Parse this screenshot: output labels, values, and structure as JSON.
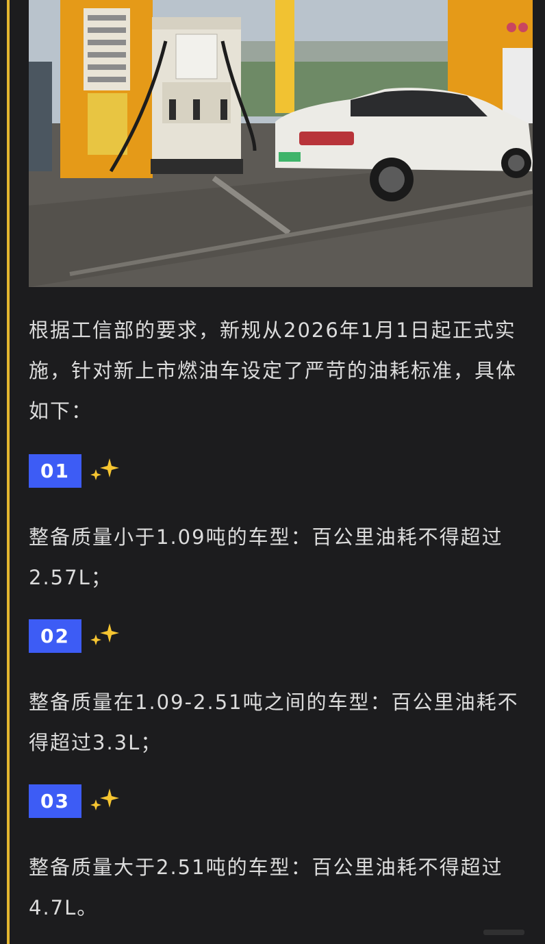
{
  "article": {
    "photo_alt": "加油站内一辆白色轿车正在加油",
    "intro": "根据工信部的要求，新规从2026年1月1日起正式实施，针对新上市燃油车设定了严苛的油耗标准，具体如下：",
    "items": [
      {
        "badge": "01",
        "text": "整备质量小于1.09吨的车型：百公里油耗不得超过2.57L；"
      },
      {
        "badge": "02",
        "text": "整备质量在1.09-2.51吨之间的车型：百公里油耗不得超过3.3L；"
      },
      {
        "badge": "03",
        "text": "整备质量大于2.51吨的车型：百公里油耗不得超过4.7L。"
      }
    ]
  },
  "colors": {
    "background": "#1c1c1e",
    "accent_bar": "#e3b52f",
    "badge": "#3d5cf5",
    "sparkle": "#f6c531",
    "text": "#dcdcdc"
  },
  "icons": {
    "sparkle": "sparkles-icon"
  }
}
